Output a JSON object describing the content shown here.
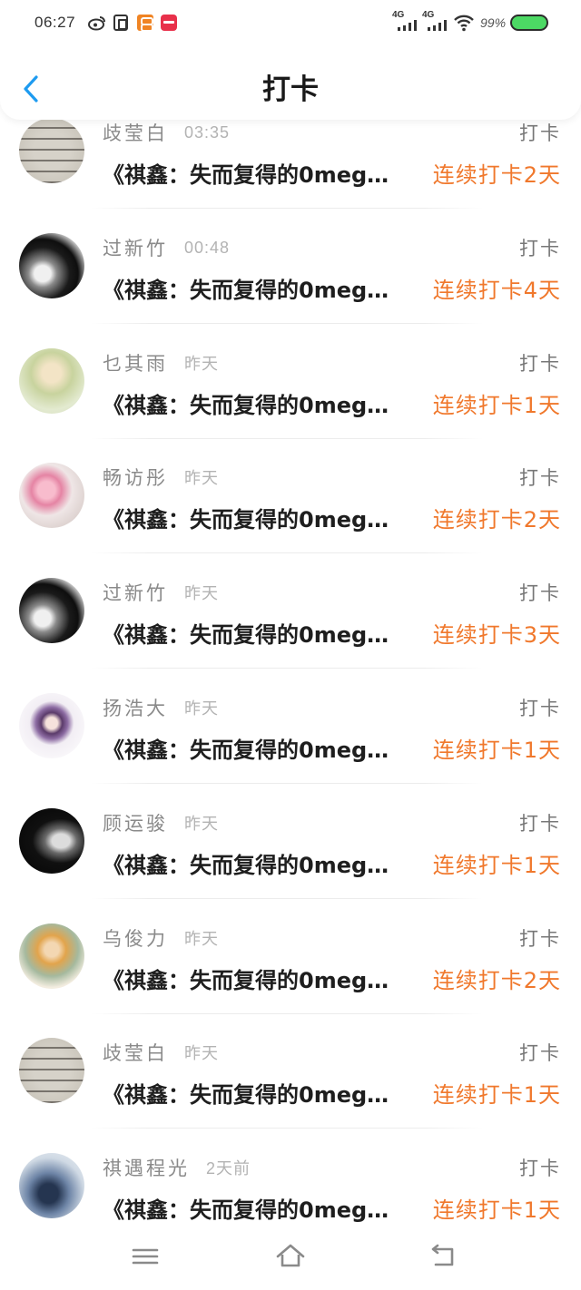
{
  "status": {
    "time": "06:27",
    "icons": [
      "weibo-icon",
      "app-icon",
      "app-icon",
      "app-icon"
    ],
    "network_1": "4G",
    "network_2": "4G",
    "battery": "99%"
  },
  "header": {
    "title": "打卡",
    "back_icon": "chevron-left-icon"
  },
  "rows": [
    {
      "name": "歧莹白",
      "time": "03:35",
      "type": "打卡",
      "book": "《祺鑫：失而复得的0meg…",
      "streak": "连续打卡2天"
    },
    {
      "name": "过新竹",
      "time": "00:48",
      "type": "打卡",
      "book": "《祺鑫：失而复得的0meg…",
      "streak": "连续打卡4天"
    },
    {
      "name": "乜其雨",
      "time": "昨天",
      "type": "打卡",
      "book": "《祺鑫：失而复得的0meg…",
      "streak": "连续打卡1天"
    },
    {
      "name": "畅访彤",
      "time": "昨天",
      "type": "打卡",
      "book": "《祺鑫：失而复得的0meg…",
      "streak": "连续打卡2天"
    },
    {
      "name": "过新竹",
      "time": "昨天",
      "type": "打卡",
      "book": "《祺鑫：失而复得的0meg…",
      "streak": "连续打卡3天"
    },
    {
      "name": "扬浩大",
      "time": "昨天",
      "type": "打卡",
      "book": "《祺鑫：失而复得的0meg…",
      "streak": "连续打卡1天"
    },
    {
      "name": "顾运骏",
      "time": "昨天",
      "type": "打卡",
      "book": "《祺鑫：失而复得的0meg…",
      "streak": "连续打卡1天"
    },
    {
      "name": "乌俊力",
      "time": "昨天",
      "type": "打卡",
      "book": "《祺鑫：失而复得的0meg…",
      "streak": "连续打卡2天"
    },
    {
      "name": "歧莹白",
      "time": "昨天",
      "type": "打卡",
      "book": "《祺鑫：失而复得的0meg…",
      "streak": "连续打卡1天"
    },
    {
      "name": "祺遇程光",
      "time": "2天前",
      "type": "打卡",
      "book": "《祺鑫：失而复得的0meg…",
      "streak": "连续打卡1天"
    }
  ],
  "nav": {
    "icons": [
      "menu-icon",
      "home-icon",
      "back-icon"
    ]
  },
  "colors": {
    "accent": "#1e9bf0",
    "streak": "#f0782c",
    "battery": "#4cd964"
  }
}
